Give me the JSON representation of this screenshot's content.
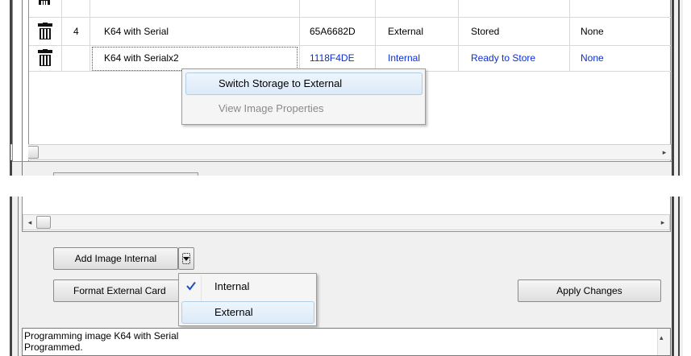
{
  "table": {
    "rows": [
      {
        "index": "",
        "name": "",
        "checksum": "",
        "storage": "",
        "status": "",
        "extra": ""
      },
      {
        "index": "4",
        "name": "K64 with Serial",
        "checksum": "65A6682D",
        "storage": "External",
        "status": "Stored",
        "extra": "None"
      },
      {
        "index": "",
        "name": "K64 with Serialx2",
        "checksum": "1118F4DE",
        "storage": "Internal",
        "status": "Ready to Store",
        "extra": "None",
        "pending": true
      }
    ]
  },
  "context_menu": {
    "items": [
      {
        "label": "Switch Storage to External",
        "enabled": true,
        "highlighted": true
      },
      {
        "label": "View Image Properties",
        "enabled": false
      }
    ]
  },
  "buttons": {
    "add_image": "Add Image Internal",
    "format_card": "Format External Card",
    "apply": "Apply Changes"
  },
  "storage_dropdown": {
    "items": [
      {
        "label": "Internal",
        "checked": true
      },
      {
        "label": "External",
        "highlighted": true
      }
    ]
  },
  "log": {
    "lines": [
      "Programming image K64 with Serial",
      "Programmed."
    ]
  },
  "colors": {
    "pending_text": "#0a2fd6",
    "menu_highlight": "#dbeaf9",
    "check_mark": "#1f4fb5"
  },
  "icons": [
    "trash-icon",
    "scroll-left-arrow-icon",
    "scroll-right-arrow-icon",
    "dropdown-arrow-icon",
    "check-icon",
    "scroll-up-arrow-icon"
  ]
}
